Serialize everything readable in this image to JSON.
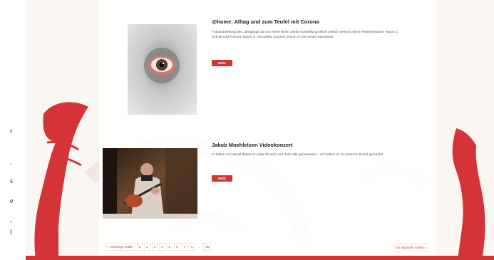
{
  "side_strip": {
    "chars": [
      {
        "t": "r",
        "top": 0
      },
      {
        "t": ".",
        "top": 0
      },
      {
        "t": "s",
        "top": 0
      },
      {
        "t": "e",
        "top": 0
      },
      {
        "t": ",",
        "top": 0
      },
      {
        "t": "l",
        "top": 0
      }
    ]
  },
  "posts": [
    {
      "title": "@home: Alltag und zum Teufel mit Corona",
      "text": "Fotoausstellung des Jahrgangs 10 von Herrn Mohr. Diese Ausstellung öffnet zeitlich versetzt seine Themenräume. Raum 1: Schule und Freizeit, Raum 2: (virtuelles) Konzert, Raum 3: Die neuen Standards",
      "more": "Mehr"
    },
    {
      "title": "Jakob Moehlelsen Videokonzert",
      "text": "In Zeiten von social distance: jeder für sich und doch alle gemeinsam – wir haben es zu unserem Event gemacht!",
      "more": "Mehr"
    }
  ],
  "pagination": {
    "prev": "« Vorherige Artikel",
    "pages": [
      "1",
      "2",
      "3",
      "4",
      "5",
      "6",
      "7",
      "8",
      "...",
      "35"
    ],
    "next": "Zur nächsten Artikel »"
  },
  "colors": {
    "accent": "#d43438",
    "page_bg": "#faf7f3"
  }
}
